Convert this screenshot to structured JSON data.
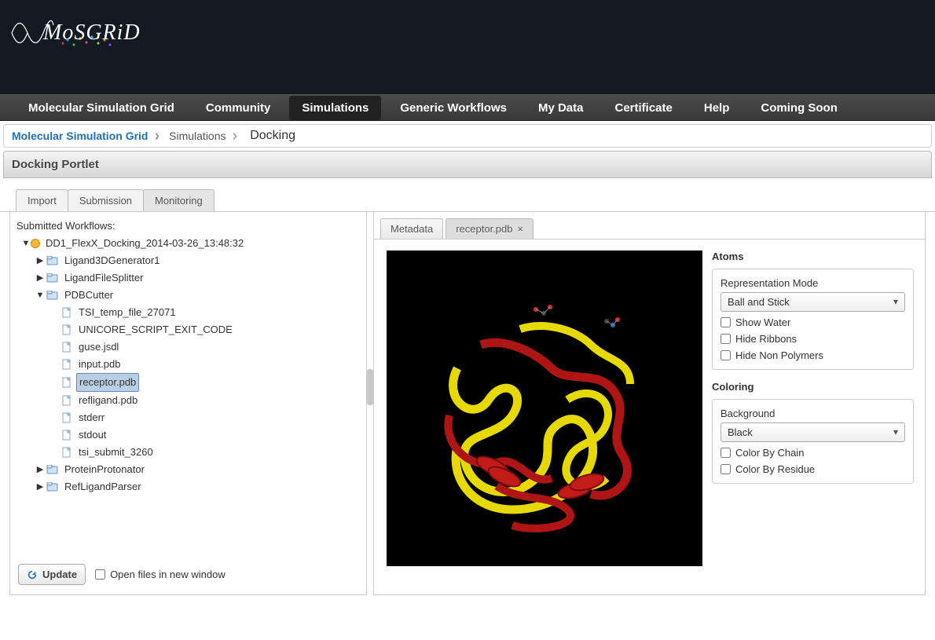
{
  "logo_text": "MoSGRiD",
  "nav": {
    "items": [
      {
        "label": "Molecular Simulation Grid",
        "active": false
      },
      {
        "label": "Community",
        "active": false
      },
      {
        "label": "Simulations",
        "active": true
      },
      {
        "label": "Generic Workflows",
        "active": false
      },
      {
        "label": "My Data",
        "active": false
      },
      {
        "label": "Certificate",
        "active": false
      },
      {
        "label": "Help",
        "active": false
      },
      {
        "label": "Coming Soon",
        "active": false
      }
    ]
  },
  "breadcrumb": {
    "items": [
      {
        "label": "Molecular Simulation Grid",
        "kind": "link"
      },
      {
        "label": "Simulations",
        "kind": "link2"
      },
      {
        "label": "Docking",
        "kind": "current"
      }
    ]
  },
  "portlet_title": "Docking Portlet",
  "outer_tabs": [
    {
      "label": "Import",
      "active": false
    },
    {
      "label": "Submission",
      "active": false
    },
    {
      "label": "Monitoring",
      "active": true
    }
  ],
  "left": {
    "title": "Submitted Workflows:",
    "workflow_label": "DD1_FlexX_Docking_2014-03-26_13:48:32",
    "nodes": {
      "ligand3d": "Ligand3DGenerator1",
      "ligandsplit": "LigandFileSplitter",
      "pdbcutter": "PDBCutter",
      "files": {
        "tsi_temp": "TSI_temp_file_27071",
        "unicore": "UNICORE_SCRIPT_EXIT_CODE",
        "guse": "guse.jsdl",
        "input": "input.pdb",
        "receptor": "receptor.pdb",
        "refligand": "refligand.pdb",
        "stderr": "stderr",
        "stdout": "stdout",
        "tsi_submit": "tsi_submit_3260"
      },
      "proteinprot": "ProteinProtonator",
      "refligparser": "RefLigandParser"
    },
    "update_label": "Update",
    "open_new_window_label": "Open files in new window"
  },
  "inner_tabs": [
    {
      "label": "Metadata",
      "closable": false,
      "active": false
    },
    {
      "label": "receptor.pdb",
      "closable": true,
      "active": true
    }
  ],
  "atoms": {
    "title": "Atoms",
    "rep_label": "Representation Mode",
    "rep_value": "Ball and Stick",
    "show_water": "Show Water",
    "hide_ribbons": "Hide Ribbons",
    "hide_nonpoly": "Hide Non Polymers"
  },
  "coloring": {
    "title": "Coloring",
    "bg_label": "Background",
    "bg_value": "Black",
    "by_chain": "Color By Chain",
    "by_residue": "Color By Residue"
  }
}
